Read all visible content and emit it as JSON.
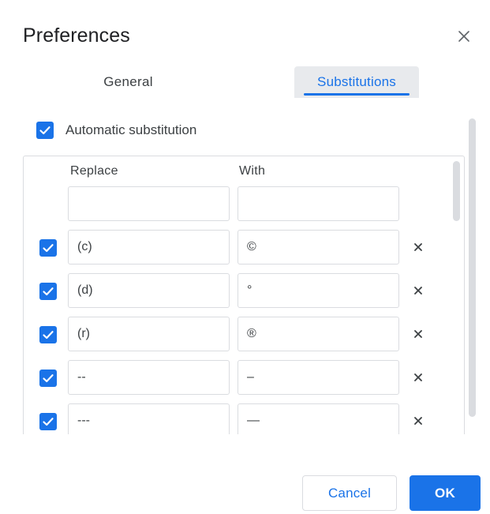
{
  "dialog": {
    "title": "Preferences",
    "close_icon": "close-icon"
  },
  "tabs": [
    {
      "label": "General",
      "active": false
    },
    {
      "label": "Substitutions",
      "active": true
    }
  ],
  "automatic_substitution": {
    "label": "Automatic substitution",
    "checked": true
  },
  "table": {
    "headers": {
      "replace": "Replace",
      "with": "With"
    },
    "new_row": {
      "replace": "",
      "with": ""
    },
    "rows": [
      {
        "checked": true,
        "replace": "(c)",
        "with": "©"
      },
      {
        "checked": true,
        "replace": "(d)",
        "with": "°"
      },
      {
        "checked": true,
        "replace": "(r)",
        "with": "®"
      },
      {
        "checked": true,
        "replace": "--",
        "with": "–"
      },
      {
        "checked": true,
        "replace": "---",
        "with": "—"
      }
    ]
  },
  "buttons": {
    "cancel": "Cancel",
    "ok": "OK"
  },
  "colors": {
    "accent": "#1a73e8",
    "tab_active_bg": "#e8eaed",
    "border": "#dadce0"
  }
}
